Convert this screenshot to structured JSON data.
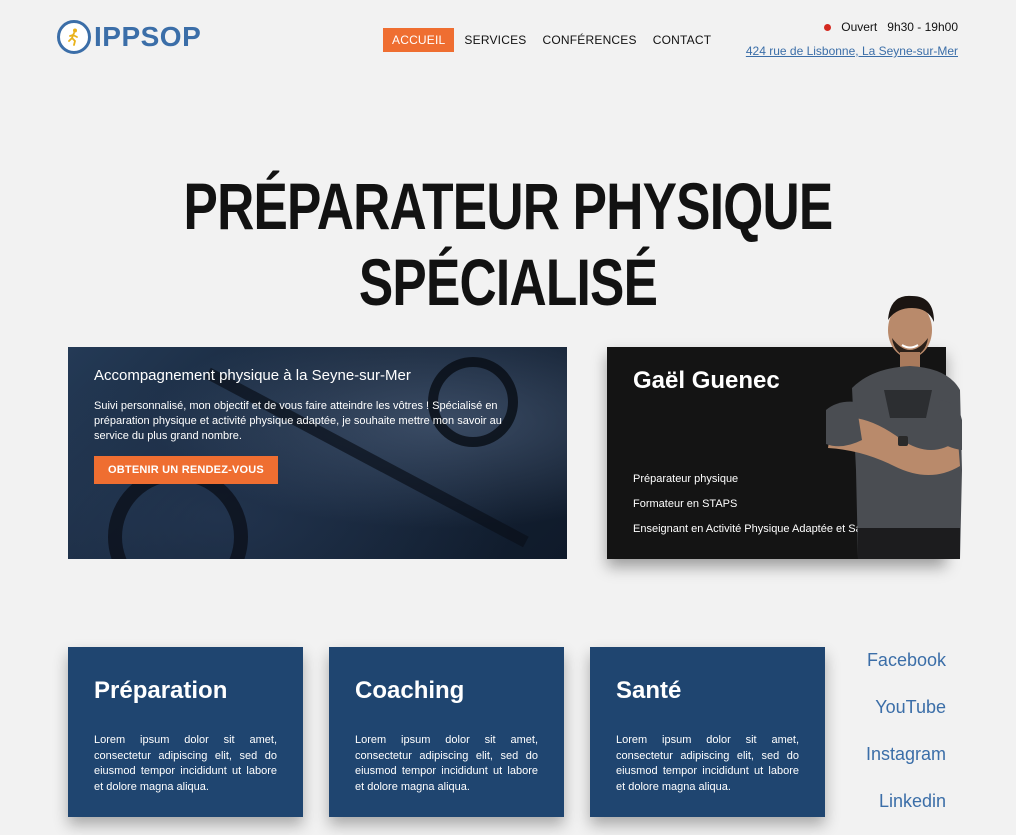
{
  "brand": {
    "name": "IPPSOP",
    "color": "#3b6ea8"
  },
  "nav": [
    {
      "label": "ACCUEIL",
      "active": true
    },
    {
      "label": "SERVICES",
      "active": false
    },
    {
      "label": "CONFÉRENCES",
      "active": false
    },
    {
      "label": "CONTACT",
      "active": false
    }
  ],
  "status": {
    "state": "Ouvert",
    "hours": "9h30 - 19h00",
    "indicator_color": "#d42a20"
  },
  "address": "424 rue de Lisbonne, La Seyne-sur-Mer",
  "hero": {
    "title": "PRÉPARATEUR PHYSIQUE SPÉCIALISÉ",
    "card_title": "Accompagnement physique à la Seyne-sur-Mer",
    "card_text": "Suivi personnalisé, mon objectif et de vous faire atteindre les vôtres ! Spécialisé en préparation physique et activité physique adaptée, je souhaite mettre mon savoir au service du plus grand nombre.",
    "cta": "OBTENIR UN RENDEZ-VOUS"
  },
  "profile": {
    "name": "Gaël Guenec",
    "roles": [
      "Préparateur physique",
      "Formateur en STAPS",
      "Enseignant en Activité Physique Adaptée et Santé"
    ]
  },
  "services": [
    {
      "title": "Préparation",
      "text": "Lorem ipsum dolor sit amet, consectetur adipiscing elit, sed do eiusmod tempor incididunt ut labore et dolore magna aliqua."
    },
    {
      "title": "Coaching",
      "text": "Lorem ipsum dolor sit amet, consectetur adipiscing elit, sed do eiusmod tempor incididunt ut labore et dolore magna aliqua."
    },
    {
      "title": "Santé",
      "text": "Lorem ipsum dolor sit amet, consectetur adipiscing elit, sed do eiusmod tempor incididunt ut labore et dolore magna aliqua."
    }
  ],
  "socials": [
    "Facebook",
    "YouTube",
    "Instagram",
    "Linkedin"
  ],
  "colors": {
    "accent": "#ef6e31",
    "card_blue": "#1f4570",
    "background": "#f2f2f2"
  }
}
